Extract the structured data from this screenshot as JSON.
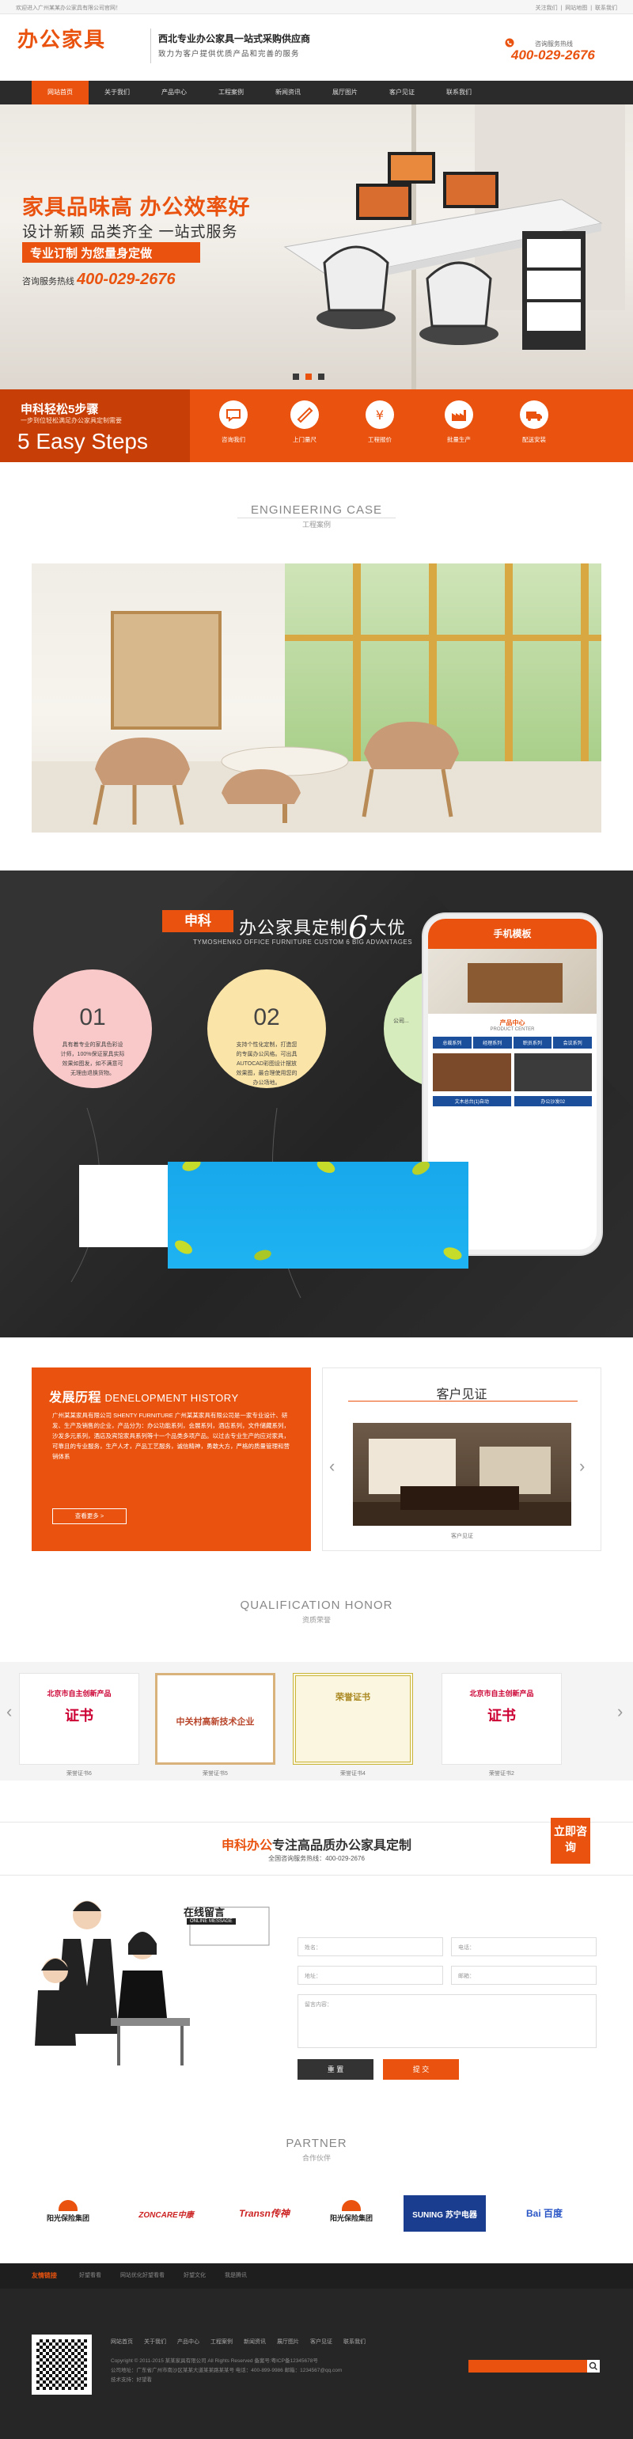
{
  "topbar": {
    "welcome": "欢迎进入广州某某办公家具有限公司官网！",
    "links": "关注我们 | 网站地图 | 联系我们"
  },
  "header": {
    "logo": "办公家具",
    "slogan_main": "西北专业办公家具一站式采购供应商",
    "slogan_sub": "致力为客户提供优质产品和完善的服务",
    "hotline_label": "咨询服务热线",
    "hotline": "400-029-2676"
  },
  "nav": {
    "items": [
      "网站首页",
      "关于我们",
      "产品中心",
      "工程案例",
      "新闻资讯",
      "展厅图片",
      "客户见证",
      "联系我们"
    ]
  },
  "banner": {
    "title": "家具品味高  办公效率好",
    "subtitle": "设计新颖 品类齐全 一站式服务",
    "tag": "专业订制  为您量身定做",
    "phone_label": "咨询服务热线",
    "phone": "400-029-2676"
  },
  "steps": {
    "title": "申科轻松5步骤",
    "subtitle": "一步到位轻松满足办公家具定制需要",
    "big": "5 Easy Steps",
    "items": [
      {
        "label": "咨询我们",
        "icon": "chat-icon"
      },
      {
        "label": "上门量尺",
        "icon": "ruler-icon"
      },
      {
        "label": "工程报价",
        "icon": "yen-icon"
      },
      {
        "label": "批量生产",
        "icon": "factory-icon"
      },
      {
        "label": "配送安装",
        "icon": "truck-icon"
      }
    ]
  },
  "engineering": {
    "title_en": "ENGINEERING CASE",
    "title_cn": "工程案例"
  },
  "advantages": {
    "brand": "申科",
    "title": "办公家具定制",
    "six": "6",
    "title_end": "大优",
    "subtitle": "TYMOSHENKO OFFICE FURNITURE CUSTOM 6 BIG ADVANTAGES",
    "items": [
      {
        "no": "01",
        "desc": "具有着专业的家具色彩设计师，100%保证家具实际效果如图发，如不满意可无理由退换货物。"
      },
      {
        "no": "02",
        "desc": "支持个性化定制，打造您的专属办公风格。可出具AUTOCAD彩图设计摆放效果图，最合理使用您的办公场地。"
      },
      {
        "no": "03",
        "desc": "公司..."
      }
    ]
  },
  "mobile": {
    "header": "手机模板",
    "product_title": "产品中心",
    "product_en": "PRODUCT CENTER",
    "tabs": [
      "总裁系列",
      "经理系列",
      "职员系列",
      "会议系列"
    ],
    "captions": [
      "文木总台(1)自动",
      "办公沙发02"
    ]
  },
  "history": {
    "title": "发展历程",
    "title_en": "DENELOPMENT HISTORY",
    "desc": "广州某某家具有限公司 SHENTY FURNITURE 广州某某家具有限公司是一家专业设计、研发、生产及销售的企业，产品分为：办公功能系列，会展系列，酒店系列，文件储藏系列，沙发多元系列，酒店及宾馆家具系列等十一个品类多项产品。以过去专业生产的应对家具，可靠且的专业服务，生产人才，产品工艺服务，诚信精神，勇敢大方，严格的质量管理和营销体系",
    "more": "查看更多 >"
  },
  "testimonials": {
    "title": "客户见证",
    "caption": "客户见证"
  },
  "honor": {
    "title_en": "QUALIFICATION HONOR",
    "title_cn": "资质荣誉",
    "items": [
      {
        "caption": "荣誉证书6",
        "header": "北京市自主创新产品",
        "title": "证书"
      },
      {
        "caption": "荣誉证书5",
        "header": "中关村高新技术企业",
        "title": ""
      },
      {
        "caption": "荣誉证书4",
        "header": "荣誉证书",
        "title": ""
      },
      {
        "caption": "荣誉证书2",
        "header": "北京市自主创新产品",
        "title": "证书"
      }
    ]
  },
  "custom": {
    "brand": "申科办公",
    "title": "专注高品质办公家具定制",
    "hotline_label": "全国咨询服务热线：",
    "hotline": "400-029-2676",
    "stamp": "立即咨询",
    "message_sign": "在线留言",
    "message_en": "ONLINE MESSAGE",
    "fields": {
      "name": "姓名：",
      "phone": "电话：",
      "address": "地址：",
      "email": "邮箱：",
      "content": "留言内容："
    },
    "reset": "重 置",
    "submit": "提 交"
  },
  "partner": {
    "title_en": "PARTNER",
    "title_cn": "合作伙伴",
    "items": [
      "阳光保险集团",
      "ZONCARE中康",
      "Transn传神",
      "阳光保险集团",
      "SUNING 苏宁电器",
      "Bai 百度"
    ]
  },
  "footer": {
    "links_title": "友情链接",
    "links": [
      "好望看看",
      "网站优化好望看看",
      "好望文化",
      "我是腾讯"
    ],
    "nav": [
      "网站首页",
      "关于我们",
      "产品中心",
      "工程案例",
      "新闻资讯",
      "展厅图片",
      "客户见证",
      "联系我们"
    ],
    "copyright": "Copyright © 2011-2015 某某家具有限公司 All Rights Reserved  备案号:粤ICP备12345678号",
    "company": "公司地址：广东省广州市南沙区某某大道某某路某某号   电话：400-899-9986   邮箱：1234567@qq.com",
    "support": "技术支持：好望看"
  }
}
